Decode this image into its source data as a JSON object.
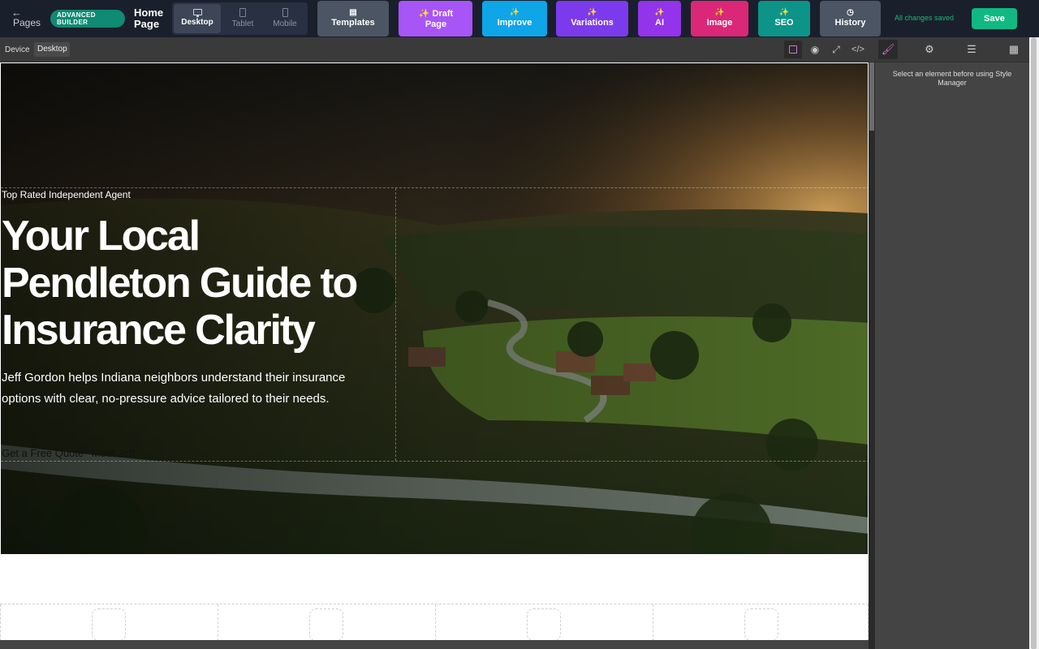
{
  "topbar": {
    "back_label": "Pages",
    "badge": "ADVANCED BUILDER",
    "page_title": "Home Page",
    "devices": [
      {
        "label": "Desktop",
        "active": true
      },
      {
        "label": "Tablet",
        "active": false
      },
      {
        "label": "Mobile",
        "active": false
      }
    ],
    "tools": [
      {
        "label": "Templates",
        "color": "#4b5563"
      },
      {
        "label": "✨ Draft Page",
        "color": "#a855f7"
      },
      {
        "label": "Improve",
        "color": "#0ea5e9"
      },
      {
        "label": "Variations",
        "color": "#7c3aed"
      },
      {
        "label": "AI",
        "color": "#9333ea"
      },
      {
        "label": "Image",
        "color": "#db2777"
      },
      {
        "label": "SEO",
        "color": "#0d9488"
      },
      {
        "label": "History",
        "color": "#4b5563"
      }
    ],
    "status": "All changes saved",
    "save_label": "Save"
  },
  "subbar": {
    "device_label": "Device",
    "device_value": "Desktop"
  },
  "right_panel": {
    "message": "Select an element before using Style Manager"
  },
  "hero": {
    "eyebrow": "Top Rated Independent Agent",
    "headline": "Your Local Pendleton Guide to Insurance Clarity",
    "subtext": "Jeff Gordon helps Indiana neighbors understand their insurance options with clear, no-pressure advice tailored to their needs.",
    "cta_primary": "Get a Free Quote",
    "cta_secondary": "Meet Jeff"
  }
}
